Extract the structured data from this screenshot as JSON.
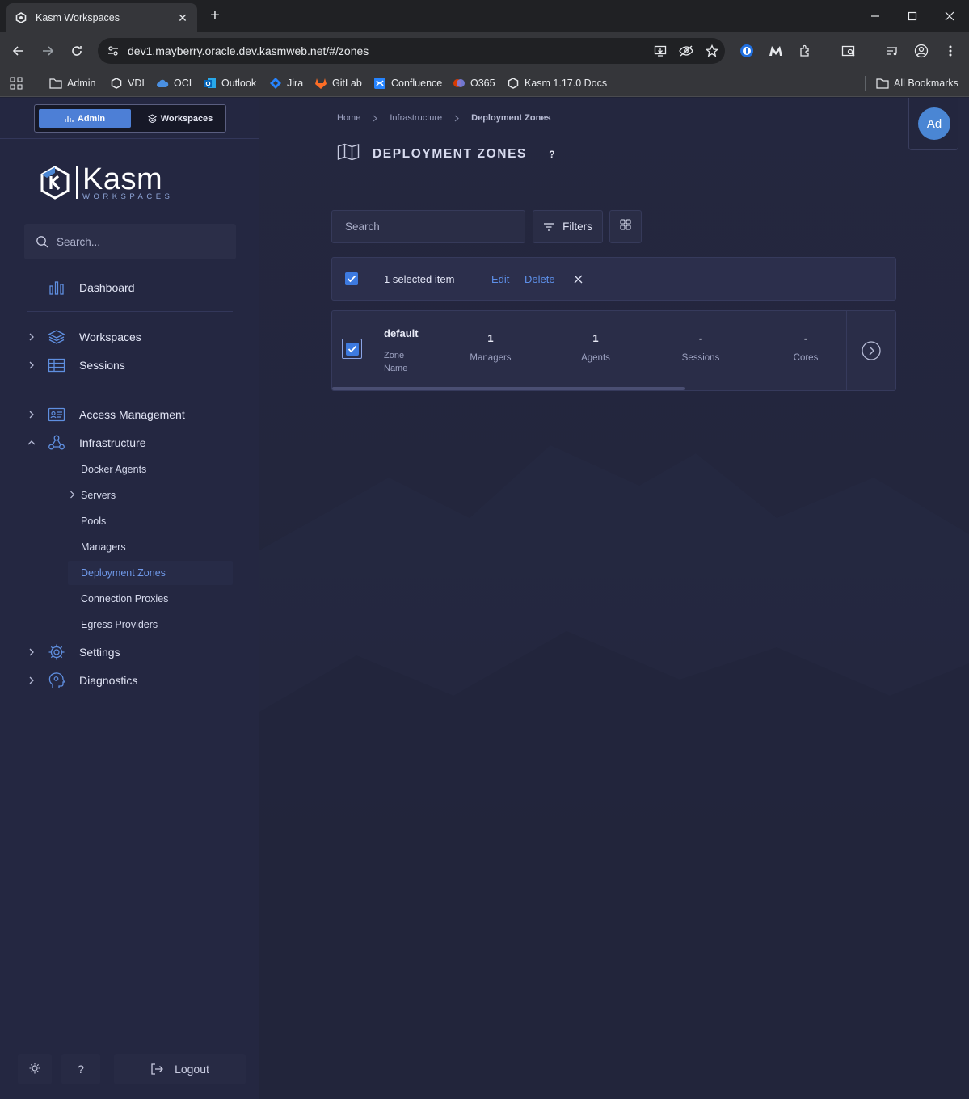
{
  "browser": {
    "tab_title": "Kasm Workspaces",
    "url": "dev1.mayberry.oracle.dev.kasmweb.net/#/zones",
    "bookmarks": [
      "Admin",
      "VDI",
      "OCI",
      "Outlook",
      "Jira",
      "GitLab",
      "Confluence",
      "O365",
      "Kasm 1.17.0 Docs"
    ],
    "all_bookmarks": "All Bookmarks"
  },
  "sidebar": {
    "mode_admin": "Admin",
    "mode_workspaces": "Workspaces",
    "logo_text": "Kasm",
    "logo_sub": "WORKSPACES",
    "search_placeholder": "Search...",
    "dashboard": "Dashboard",
    "workspaces": "Workspaces",
    "sessions": "Sessions",
    "access_management": "Access Management",
    "infrastructure": "Infrastructure",
    "infra_items": [
      "Docker Agents",
      "Servers",
      "Pools",
      "Managers",
      "Deployment Zones",
      "Connection Proxies",
      "Egress Providers"
    ],
    "settings": "Settings",
    "diagnostics": "Diagnostics",
    "help": "?",
    "logout": "Logout"
  },
  "main": {
    "breadcrumb": [
      "Home",
      "Infrastructure",
      "Deployment Zones"
    ],
    "title": "DEPLOYMENT ZONES",
    "help": "?",
    "avatar": "Ad",
    "search_placeholder": "Search",
    "filters": "Filters",
    "selection": {
      "text": "1 selected item",
      "edit": "Edit",
      "delete": "Delete"
    },
    "rows": [
      {
        "name": "default",
        "name_label": "Zone Name",
        "managers": "1",
        "managers_label": "Managers",
        "agents": "1",
        "agents_label": "Agents",
        "sessions": "-",
        "sessions_label": "Sessions",
        "cores": "-",
        "cores_label": "Cores"
      }
    ]
  },
  "colors": {
    "accent": "#4d7fd6",
    "link": "#5d8fe8",
    "sidebar_bg": "#242741",
    "main_bg": "#23263e"
  }
}
